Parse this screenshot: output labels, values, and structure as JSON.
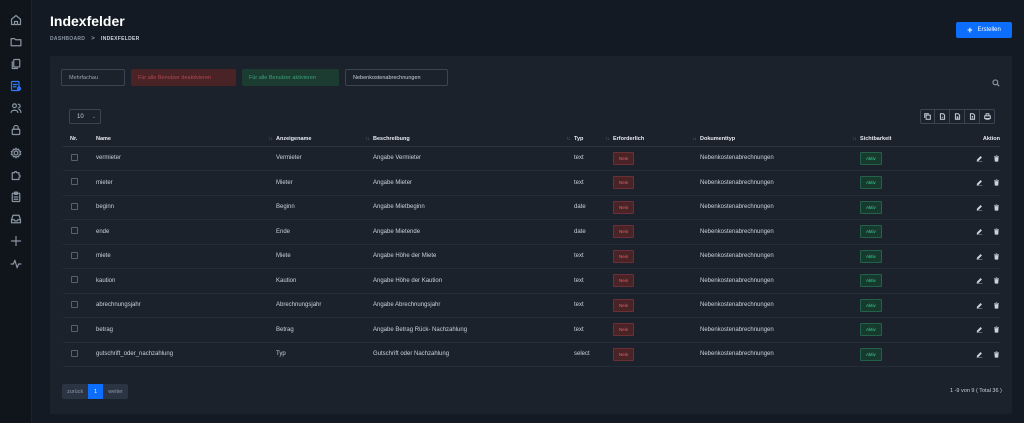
{
  "header": {
    "title": "Indexfelder",
    "breadcrumb": {
      "root": "DASHBOARD",
      "separator": ">",
      "current": "INDEXFELDER"
    },
    "create_label": "Erstellen"
  },
  "sidebar": {
    "icons": [
      "home-icon",
      "folder-icon",
      "documents-icon",
      "index-fields-icon",
      "users-icon",
      "lock-icon",
      "settings-icon",
      "puzzle-icon",
      "clipboard-icon",
      "inbox-icon",
      "plus-icon",
      "activity-icon"
    ],
    "active": "index-fields-icon"
  },
  "filters": {
    "type_placeholder": "Mehrfachau",
    "deactivate_label": "Für alle Benutzer deaktivieren",
    "activate_label": "Für alle Benutzer aktivieren",
    "doc_type_value": "Nebenkostenabrechnungen"
  },
  "table_controls": {
    "page_size": "10",
    "export_icons": [
      "copy-icon",
      "csv-icon",
      "excel-icon",
      "pdf-icon",
      "print-icon"
    ]
  },
  "table": {
    "columns": [
      "Nr.",
      "Name",
      "Anzeigename",
      "Beschreibung",
      "Typ",
      "Erforderlich",
      "Dokumenttyp",
      "Sichtbarkeit",
      "Aktion"
    ],
    "rows": [
      {
        "name": "vermieter",
        "display": "Vermieter",
        "description": "Angabe Vermieter",
        "type": "text",
        "required": "Nein",
        "doctype": "Nebenkostenabrechnungen",
        "visibility": "Aktiv"
      },
      {
        "name": "mieter",
        "display": "Mieter",
        "description": "Angabe Mieter",
        "type": "text",
        "required": "Nein",
        "doctype": "Nebenkostenabrechnungen",
        "visibility": "Aktiv"
      },
      {
        "name": "beginn",
        "display": "Beginn",
        "description": "Angabe Mietbeginn",
        "type": "date",
        "required": "Nein",
        "doctype": "Nebenkostenabrechnungen",
        "visibility": "Aktiv"
      },
      {
        "name": "ende",
        "display": "Ende",
        "description": "Angabe Mietende",
        "type": "date",
        "required": "Nein",
        "doctype": "Nebenkostenabrechnungen",
        "visibility": "Aktiv"
      },
      {
        "name": "miete",
        "display": "Miete",
        "description": "Angabe Höhe der Miete",
        "type": "text",
        "required": "Nein",
        "doctype": "Nebenkostenabrechnungen",
        "visibility": "Aktiv"
      },
      {
        "name": "kaution",
        "display": "Kaution",
        "description": "Angabe Höhe der Kaution",
        "type": "text",
        "required": "Nein",
        "doctype": "Nebenkostenabrechnungen",
        "visibility": "Aktiv"
      },
      {
        "name": "abrechnungsjahr",
        "display": "Abrechnungsjahr",
        "description": "Angabe Abrechnungsjahr",
        "type": "text",
        "required": "Nein",
        "doctype": "Nebenkostenabrechnungen",
        "visibility": "Aktiv"
      },
      {
        "name": "betrag",
        "display": "Betrag",
        "description": "Angabe Betrag Rück- Nachzahlung",
        "type": "text",
        "required": "Nein",
        "doctype": "Nebenkostenabrechnungen",
        "visibility": "Aktiv"
      },
      {
        "name": "gutschrift_oder_nachzahlung",
        "display": "Typ",
        "description": "Gutschrift oder Nachzahlung",
        "type": "select",
        "required": "Nein",
        "doctype": "Nebenkostenabrechnungen",
        "visibility": "Aktiv"
      }
    ]
  },
  "pagination": {
    "prev_label": "zurück",
    "current_page": "1",
    "next_label": "weiter",
    "summary": "1 -9 von 9 ( Total 36 )"
  }
}
